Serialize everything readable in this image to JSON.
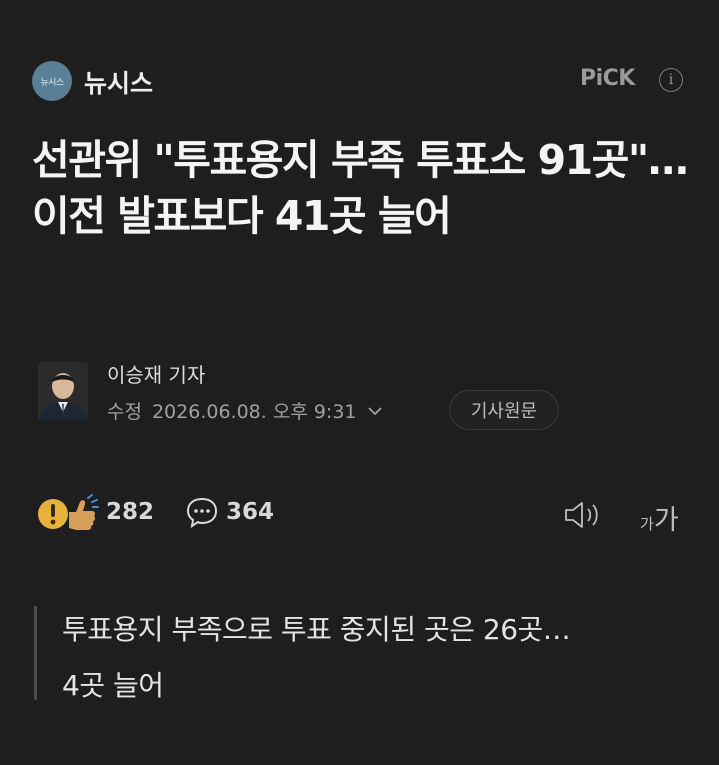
{
  "header": {
    "press_logo_text": "뉴시스",
    "press_name": "뉴시스",
    "pick_label": "PiCK",
    "info_icon": "i"
  },
  "article": {
    "headline": "선관위 \"투표용지 부족 투표소 91곳\"…이전 발표보다 41곳 늘어",
    "reporter": "이승재 기자",
    "date_label": "수정",
    "date": "2026.06.08. 오후 9:31",
    "original_button": "기사원문"
  },
  "reactions": {
    "reaction_count": "282",
    "comment_count": "364"
  },
  "font_size": {
    "small": "가",
    "big": "가"
  },
  "summary": {
    "line1": "투표용지 부족으로 투표 중지된 곳은 26곳…",
    "line2": "4곳 늘어"
  },
  "icons": [
    "press-logo",
    "info-icon",
    "reaction-icon",
    "comment-icon",
    "speaker-icon",
    "chevron-down-icon",
    "font-size-icon"
  ]
}
